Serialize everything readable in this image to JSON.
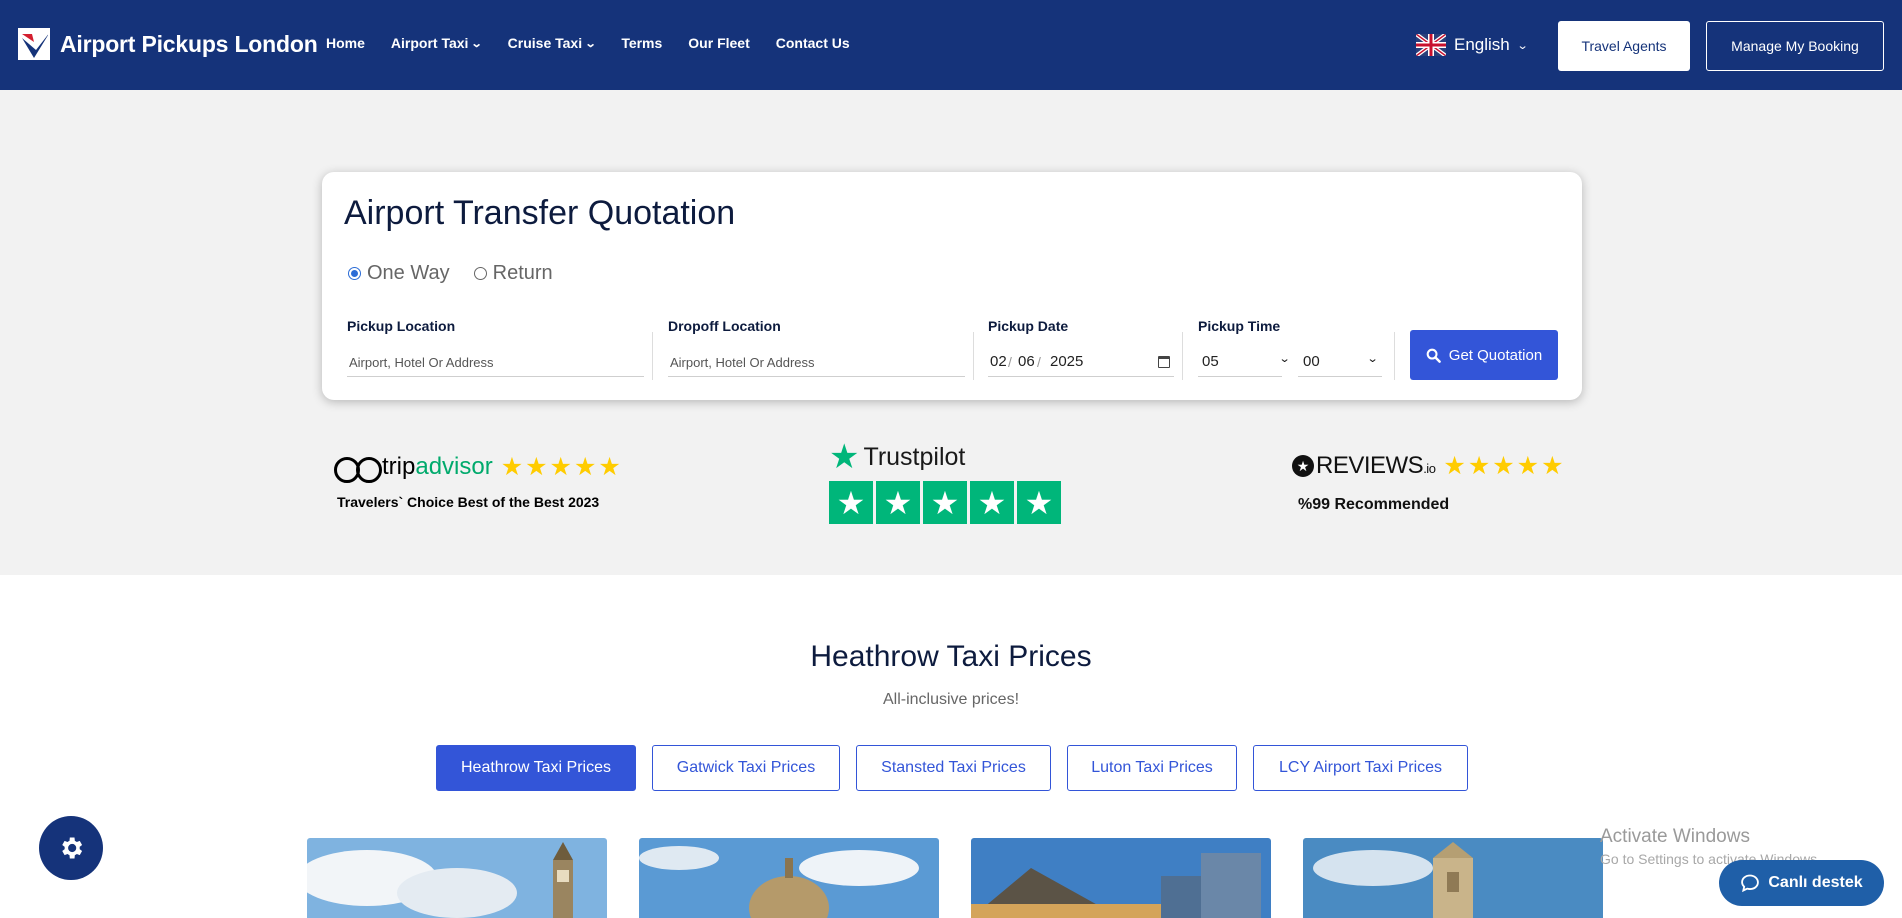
{
  "header": {
    "brand": "Airport Pickups London",
    "nav": [
      {
        "label": "Home",
        "dropdown": false
      },
      {
        "label": "Airport Taxi",
        "dropdown": true
      },
      {
        "label": "Cruise Taxi",
        "dropdown": true
      },
      {
        "label": "Terms",
        "dropdown": false
      },
      {
        "label": "Our Fleet",
        "dropdown": false
      },
      {
        "label": "Contact Us",
        "dropdown": false
      }
    ],
    "language": "English",
    "travel_agents": "Travel Agents",
    "manage_booking": "Manage My Booking",
    "bg_color": "#15337a"
  },
  "quote": {
    "title": "Airport Transfer Quotation",
    "trip_types": [
      {
        "label": "One Way",
        "selected": true
      },
      {
        "label": "Return",
        "selected": false
      }
    ],
    "pickup": {
      "label": "Pickup Location",
      "placeholder": "Airport, Hotel Or Address"
    },
    "dropoff": {
      "label": "Dropoff Location",
      "placeholder": "Airport, Hotel Or Address"
    },
    "date": {
      "label": "Pickup Date",
      "day": "02",
      "month": "06",
      "year": "2025"
    },
    "time": {
      "label": "Pickup Time",
      "hour": "05",
      "minute": "00"
    },
    "submit": "Get Quotation",
    "button_color": "#3355d8"
  },
  "reviews": {
    "tripadvisor": {
      "logo_a": "trip",
      "logo_b": "advisor",
      "stars": "★★★★★",
      "caption": "Travelers` Choice Best of the Best 2023"
    },
    "trustpilot": {
      "logo": "Trustpilot",
      "stars": 5
    },
    "reviewsio": {
      "logo": "REVIEWS",
      "suffix": ".io",
      "stars": "★★★★★",
      "caption": "%99 Recommended"
    }
  },
  "prices": {
    "title": "Heathrow Taxi Prices",
    "subtitle": "All-inclusive prices!",
    "tabs": [
      {
        "label": "Heathrow Taxi Prices",
        "active": true
      },
      {
        "label": "Gatwick Taxi Prices",
        "active": false
      },
      {
        "label": "Stansted Taxi Prices",
        "active": false
      },
      {
        "label": "Luton Taxi Prices",
        "active": false
      },
      {
        "label": "LCY Airport Taxi Prices",
        "active": false
      }
    ]
  },
  "overlay": {
    "activate_title": "Activate Windows",
    "activate_sub": "Go to Settings to activate Windows.",
    "chat": "Canlı destek"
  }
}
